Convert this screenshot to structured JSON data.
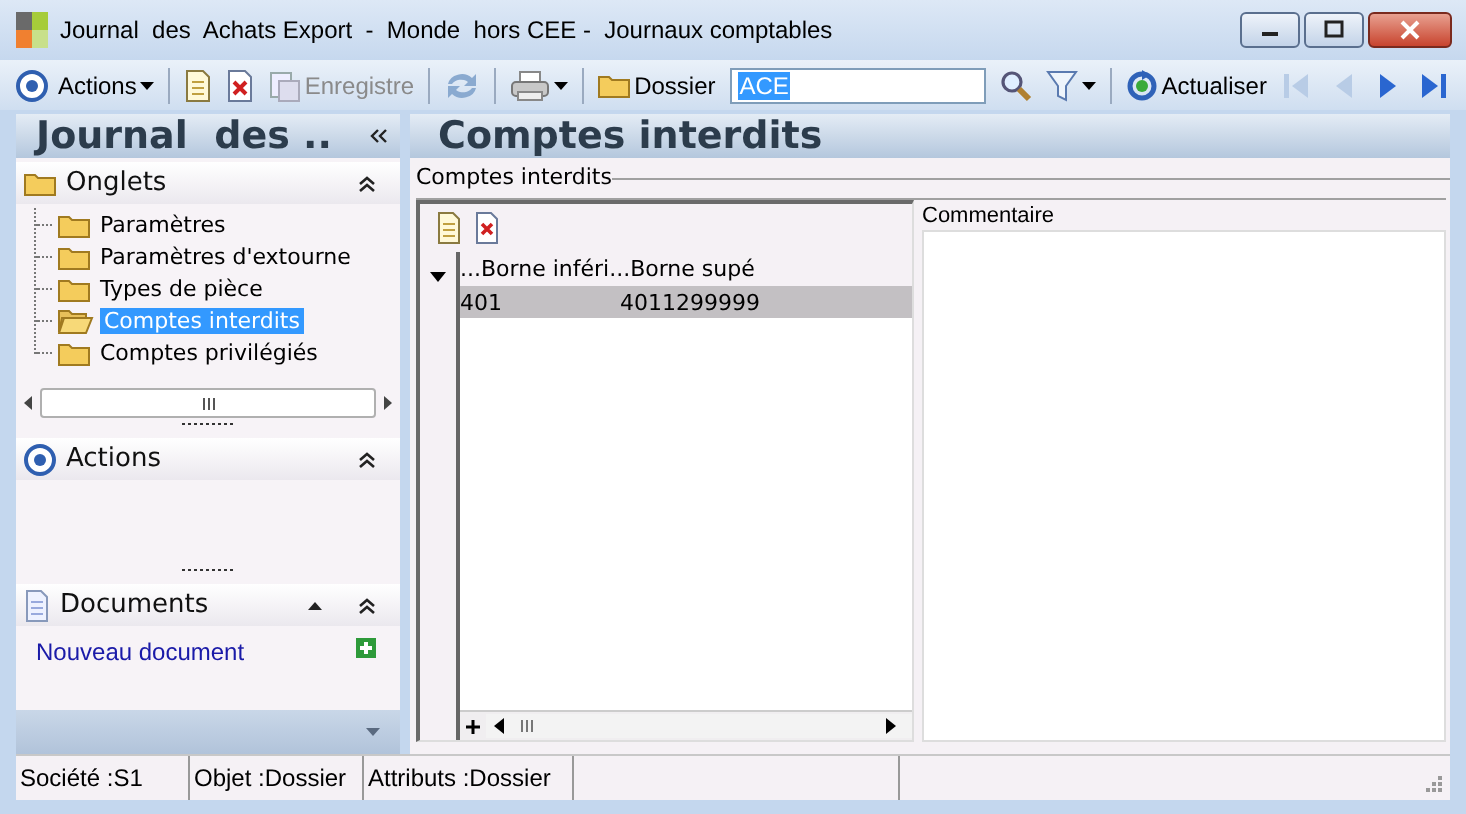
{
  "window": {
    "title": "Journal  des  Achats Export  -  Monde  hors CEE -  Journaux comptables"
  },
  "toolbar": {
    "actions_label": "Actions",
    "save": {
      "label": "Enregistre",
      "disabled": true
    },
    "folder_label": "Dossier",
    "search": {
      "value": "ACE",
      "text_selected": true
    },
    "refresh_label": "Actualiser",
    "nav": [
      {
        "kind": "first",
        "disabled": true
      },
      {
        "kind": "prev",
        "disabled": true
      },
      {
        "kind": "next",
        "disabled": false
      },
      {
        "kind": "last",
        "disabled": false
      }
    ]
  },
  "sidebar": {
    "title": "Journal  des ..",
    "sections": [
      {
        "kind": "tree",
        "title": "Onglets",
        "items": [
          {
            "label": "Paramètres",
            "selected": false
          },
          {
            "label": "Paramètres d'extourne",
            "selected": false
          },
          {
            "label": "Types de pièce",
            "selected": false
          },
          {
            "label": "Comptes interdits",
            "selected": true
          },
          {
            "label": "Comptes privilégiés",
            "selected": false
          }
        ]
      },
      {
        "kind": "empty",
        "title": "Actions"
      },
      {
        "kind": "links",
        "title": "Documents",
        "links": [
          "Nouveau document"
        ]
      }
    ]
  },
  "content": {
    "title": "Comptes interdits",
    "group_label": "Comptes interdits",
    "grid": {
      "columns": [
        "...Borne inféri",
        "...Borne supé"
      ],
      "rows": [
        {
          "cells": [
            "401",
            "4011299999"
          ],
          "selected": true
        }
      ]
    },
    "comment_label": "Commentaire"
  },
  "status_bar": [
    "Société :S1",
    "Objet :Dossier",
    "Attributs :Dossier"
  ]
}
